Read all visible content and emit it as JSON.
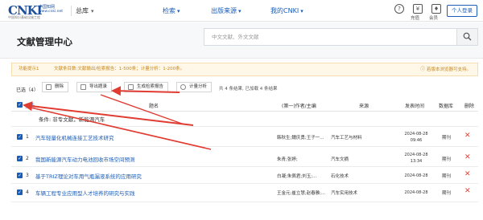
{
  "header": {
    "logo_mark": "CNKI",
    "logo_sub": "中国知网",
    "logo_url": "www.cnki.net",
    "logo_cn": "中国知识基础设施工程",
    "home": "总库",
    "nav": [
      "检索",
      "出版来源",
      "我的CNKI"
    ],
    "help": "?",
    "charge": "充值",
    "member": "会员",
    "login": "个人登录"
  },
  "page": {
    "title": "文献管理中心",
    "search_placeholder": "中文文献、外文文献"
  },
  "notice": {
    "label": "功能提示1",
    "text": "文献条目数:文献输出/检索报告：1-500条；计量分析：1-200条。",
    "right": "若版本浏览器可支持。"
  },
  "toolbar": {
    "selected": "已选（4）",
    "buttons": [
      "删除",
      "导出题录",
      "生成检索报告",
      "计量分析"
    ],
    "stat": "共 4 条结果, 已加载 4 条结果"
  },
  "table": {
    "headers": {
      "select_all": "全选",
      "title": "题名",
      "author": "(第一)作者/主编",
      "source": "来源",
      "date": "发表时间",
      "db": "数据库",
      "del": "删除"
    },
    "blank_row": "条件: 非专文献，新能源汽车",
    "rows": [
      {
        "num": "1",
        "title": "汽车轻量化机械连接工艺技术研究",
        "author": "韩秋生;魏庆勇;王子一...",
        "source": "汽车工艺与材料",
        "date1": "2024-08-28",
        "date2": "09:46",
        "db": "期刊"
      },
      {
        "num": "2",
        "title": "我国新能源汽车动力电池回收市场空间预测",
        "author": "朱青;张婷;",
        "source": "汽车文摘",
        "date1": "2024-08-28",
        "date2": "13:34",
        "db": "期刊"
      },
      {
        "num": "3",
        "title": "基于TRIZ理论对车用气瓶漏液系统的应用研究",
        "author": "白凝;朱佩君;刘玉;...",
        "source": "石化技术",
        "date1": "2024-08-28",
        "date2": "",
        "db": "期刊"
      },
      {
        "num": "4",
        "title": "车辆工程专业应用型人才培养的研究与实践",
        "author": "王金元;崔立慧;赵春雅;...",
        "source": "汽车实用技术",
        "date1": "2024-08-28",
        "date2": "",
        "db": "期刊"
      }
    ]
  },
  "colors": {
    "accent": "#1a5cb6",
    "annotation": "#e03c31",
    "notice_bg": "#fff8e8"
  }
}
